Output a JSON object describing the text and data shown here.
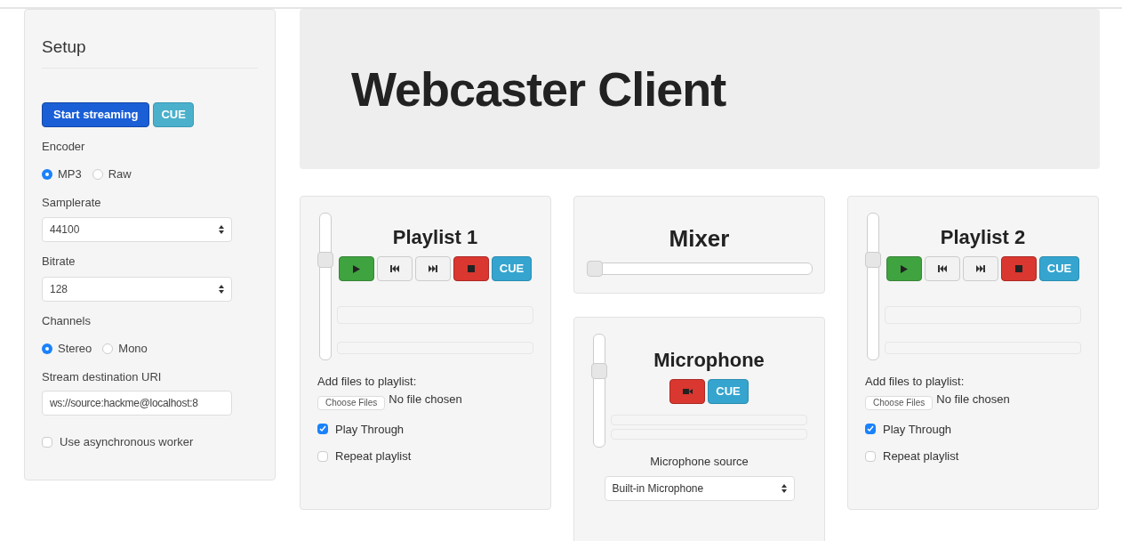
{
  "setup": {
    "title": "Setup",
    "buttons": [
      {
        "label": "Start streaming",
        "kind": "primary"
      },
      {
        "label": "CUE",
        "kind": "info"
      }
    ],
    "encoder": {
      "label": "Encoder",
      "options": [
        {
          "label": "MP3",
          "selected": true
        },
        {
          "label": "Raw",
          "selected": false
        }
      ]
    },
    "samplerate": {
      "label": "Samplerate",
      "value": "44100"
    },
    "bitrate": {
      "label": "Bitrate",
      "value": "128"
    },
    "channels": {
      "label": "Channels",
      "options": [
        {
          "label": "Stereo",
          "selected": true
        },
        {
          "label": "Mono",
          "selected": false
        }
      ]
    },
    "uri": {
      "label": "Stream destination URI",
      "value": "ws://source:hackme@localhost:8"
    },
    "async_worker": {
      "label": "Use asynchronous worker",
      "checked": false
    }
  },
  "header": {
    "title": "Webcaster Client"
  },
  "playlists": [
    {
      "title": "Playlist 1",
      "volume": {
        "level": 0.7
      },
      "controls": [
        {
          "kind": "play"
        },
        {
          "kind": "prev"
        },
        {
          "kind": "next"
        },
        {
          "kind": "stop"
        },
        {
          "kind": "cue",
          "label": "CUE"
        }
      ],
      "add_files_label": "Add files to playlist:",
      "file_button": "Choose Files",
      "file_status": "No file chosen",
      "options": [
        {
          "label": "Play Through",
          "checked": true
        },
        {
          "label": "Repeat playlist",
          "checked": false
        }
      ]
    },
    {
      "title": "Playlist 2",
      "volume": {
        "level": 0.7
      },
      "controls": [
        {
          "kind": "play"
        },
        {
          "kind": "prev"
        },
        {
          "kind": "next"
        },
        {
          "kind": "stop"
        },
        {
          "kind": "cue",
          "label": "CUE"
        }
      ],
      "add_files_label": "Add files to playlist:",
      "file_button": "Choose Files",
      "file_status": "No file chosen",
      "options": [
        {
          "label": "Play Through",
          "checked": true
        },
        {
          "label": "Repeat playlist",
          "checked": false
        }
      ]
    }
  ],
  "mixer": {
    "title": "Mixer",
    "level": 0
  },
  "microphone": {
    "title": "Microphone",
    "volume": {
      "level": 0.7
    },
    "controls": [
      {
        "kind": "record"
      },
      {
        "kind": "cue",
        "label": "CUE"
      }
    ],
    "source_label": "Microphone source",
    "source_value": "Built-in Microphone"
  }
}
